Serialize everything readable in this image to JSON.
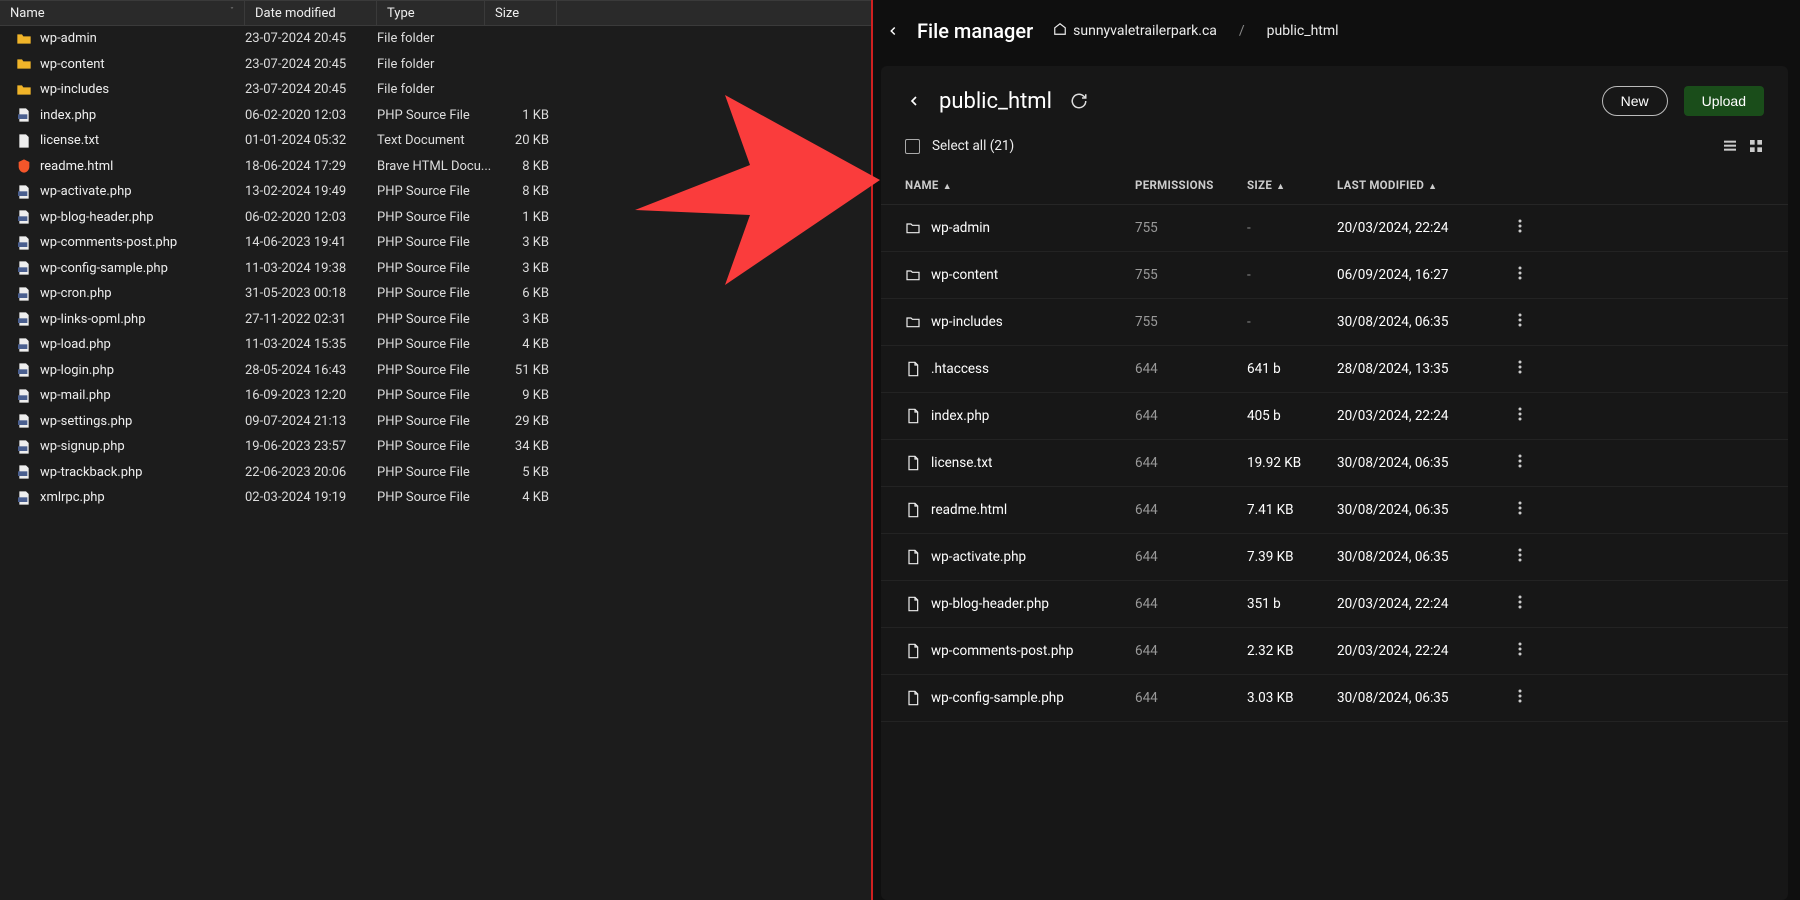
{
  "left": {
    "headers": {
      "name": "Name",
      "date": "Date modified",
      "type": "Type",
      "size": "Size"
    },
    "rows": [
      {
        "icon": "folder",
        "name": "wp-admin",
        "date": "23-07-2024 20:45",
        "type": "File folder",
        "size": ""
      },
      {
        "icon": "folder",
        "name": "wp-content",
        "date": "23-07-2024 20:45",
        "type": "File folder",
        "size": ""
      },
      {
        "icon": "folder",
        "name": "wp-includes",
        "date": "23-07-2024 20:45",
        "type": "File folder",
        "size": ""
      },
      {
        "icon": "php-file",
        "name": "index.php",
        "date": "06-02-2020 12:03",
        "type": "PHP Source File",
        "size": "1 KB"
      },
      {
        "icon": "text-file",
        "name": "license.txt",
        "date": "01-01-2024 05:32",
        "type": "Text Document",
        "size": "20 KB"
      },
      {
        "icon": "brave-file",
        "name": "readme.html",
        "date": "18-06-2024 17:29",
        "type": "Brave HTML Docu...",
        "size": "8 KB"
      },
      {
        "icon": "php-file",
        "name": "wp-activate.php",
        "date": "13-02-2024 19:49",
        "type": "PHP Source File",
        "size": "8 KB"
      },
      {
        "icon": "php-file",
        "name": "wp-blog-header.php",
        "date": "06-02-2020 12:03",
        "type": "PHP Source File",
        "size": "1 KB"
      },
      {
        "icon": "php-file",
        "name": "wp-comments-post.php",
        "date": "14-06-2023 19:41",
        "type": "PHP Source File",
        "size": "3 KB"
      },
      {
        "icon": "php-file",
        "name": "wp-config-sample.php",
        "date": "11-03-2024 19:38",
        "type": "PHP Source File",
        "size": "3 KB"
      },
      {
        "icon": "php-file",
        "name": "wp-cron.php",
        "date": "31-05-2023 00:18",
        "type": "PHP Source File",
        "size": "6 KB"
      },
      {
        "icon": "php-file",
        "name": "wp-links-opml.php",
        "date": "27-11-2022 02:31",
        "type": "PHP Source File",
        "size": "3 KB"
      },
      {
        "icon": "php-file",
        "name": "wp-load.php",
        "date": "11-03-2024 15:35",
        "type": "PHP Source File",
        "size": "4 KB"
      },
      {
        "icon": "php-file",
        "name": "wp-login.php",
        "date": "28-05-2024 16:43",
        "type": "PHP Source File",
        "size": "51 KB"
      },
      {
        "icon": "php-file",
        "name": "wp-mail.php",
        "date": "16-09-2023 12:20",
        "type": "PHP Source File",
        "size": "9 KB"
      },
      {
        "icon": "php-file",
        "name": "wp-settings.php",
        "date": "09-07-2024 21:13",
        "type": "PHP Source File",
        "size": "29 KB"
      },
      {
        "icon": "php-file",
        "name": "wp-signup.php",
        "date": "19-06-2023 23:57",
        "type": "PHP Source File",
        "size": "34 KB"
      },
      {
        "icon": "php-file",
        "name": "wp-trackback.php",
        "date": "22-06-2023 20:06",
        "type": "PHP Source File",
        "size": "5 KB"
      },
      {
        "icon": "php-file",
        "name": "xmlrpc.php",
        "date": "02-03-2024 19:19",
        "type": "PHP Source File",
        "size": "4 KB"
      }
    ]
  },
  "right": {
    "breadcrumb": {
      "title": "File manager",
      "domain": "sunnyvaletrailerpark.ca",
      "current": "public_html"
    },
    "card": {
      "title": "public_html",
      "new_btn": "New",
      "upload_btn": "Upload",
      "select_all": "Select all (21)"
    },
    "thead": {
      "name": "NAME",
      "perm": "PERMISSIONS",
      "size": "SIZE",
      "mod": "LAST MODIFIED"
    },
    "rows": [
      {
        "icon": "folder-outline",
        "name": "wp-admin",
        "perm": "755",
        "size": "-",
        "mod": "20/03/2024, 22:24"
      },
      {
        "icon": "folder-outline",
        "name": "wp-content",
        "perm": "755",
        "size": "-",
        "mod": "06/09/2024, 16:27"
      },
      {
        "icon": "folder-outline",
        "name": "wp-includes",
        "perm": "755",
        "size": "-",
        "mod": "30/08/2024, 06:35"
      },
      {
        "icon": "file-outline",
        "name": ".htaccess",
        "perm": "644",
        "size": "641 b",
        "mod": "28/08/2024, 13:35"
      },
      {
        "icon": "file-outline",
        "name": "index.php",
        "perm": "644",
        "size": "405 b",
        "mod": "20/03/2024, 22:24"
      },
      {
        "icon": "file-outline",
        "name": "license.txt",
        "perm": "644",
        "size": "19.92 KB",
        "mod": "30/08/2024, 06:35"
      },
      {
        "icon": "file-outline",
        "name": "readme.html",
        "perm": "644",
        "size": "7.41 KB",
        "mod": "30/08/2024, 06:35"
      },
      {
        "icon": "file-outline",
        "name": "wp-activate.php",
        "perm": "644",
        "size": "7.39 KB",
        "mod": "30/08/2024, 06:35"
      },
      {
        "icon": "file-outline",
        "name": "wp-blog-header.php",
        "perm": "644",
        "size": "351 b",
        "mod": "20/03/2024, 22:24"
      },
      {
        "icon": "file-outline",
        "name": "wp-comments-post.php",
        "perm": "644",
        "size": "2.32 KB",
        "mod": "20/03/2024, 22:24"
      },
      {
        "icon": "file-outline",
        "name": "wp-config-sample.php",
        "perm": "644",
        "size": "3.03 KB",
        "mod": "30/08/2024, 06:35"
      }
    ]
  }
}
